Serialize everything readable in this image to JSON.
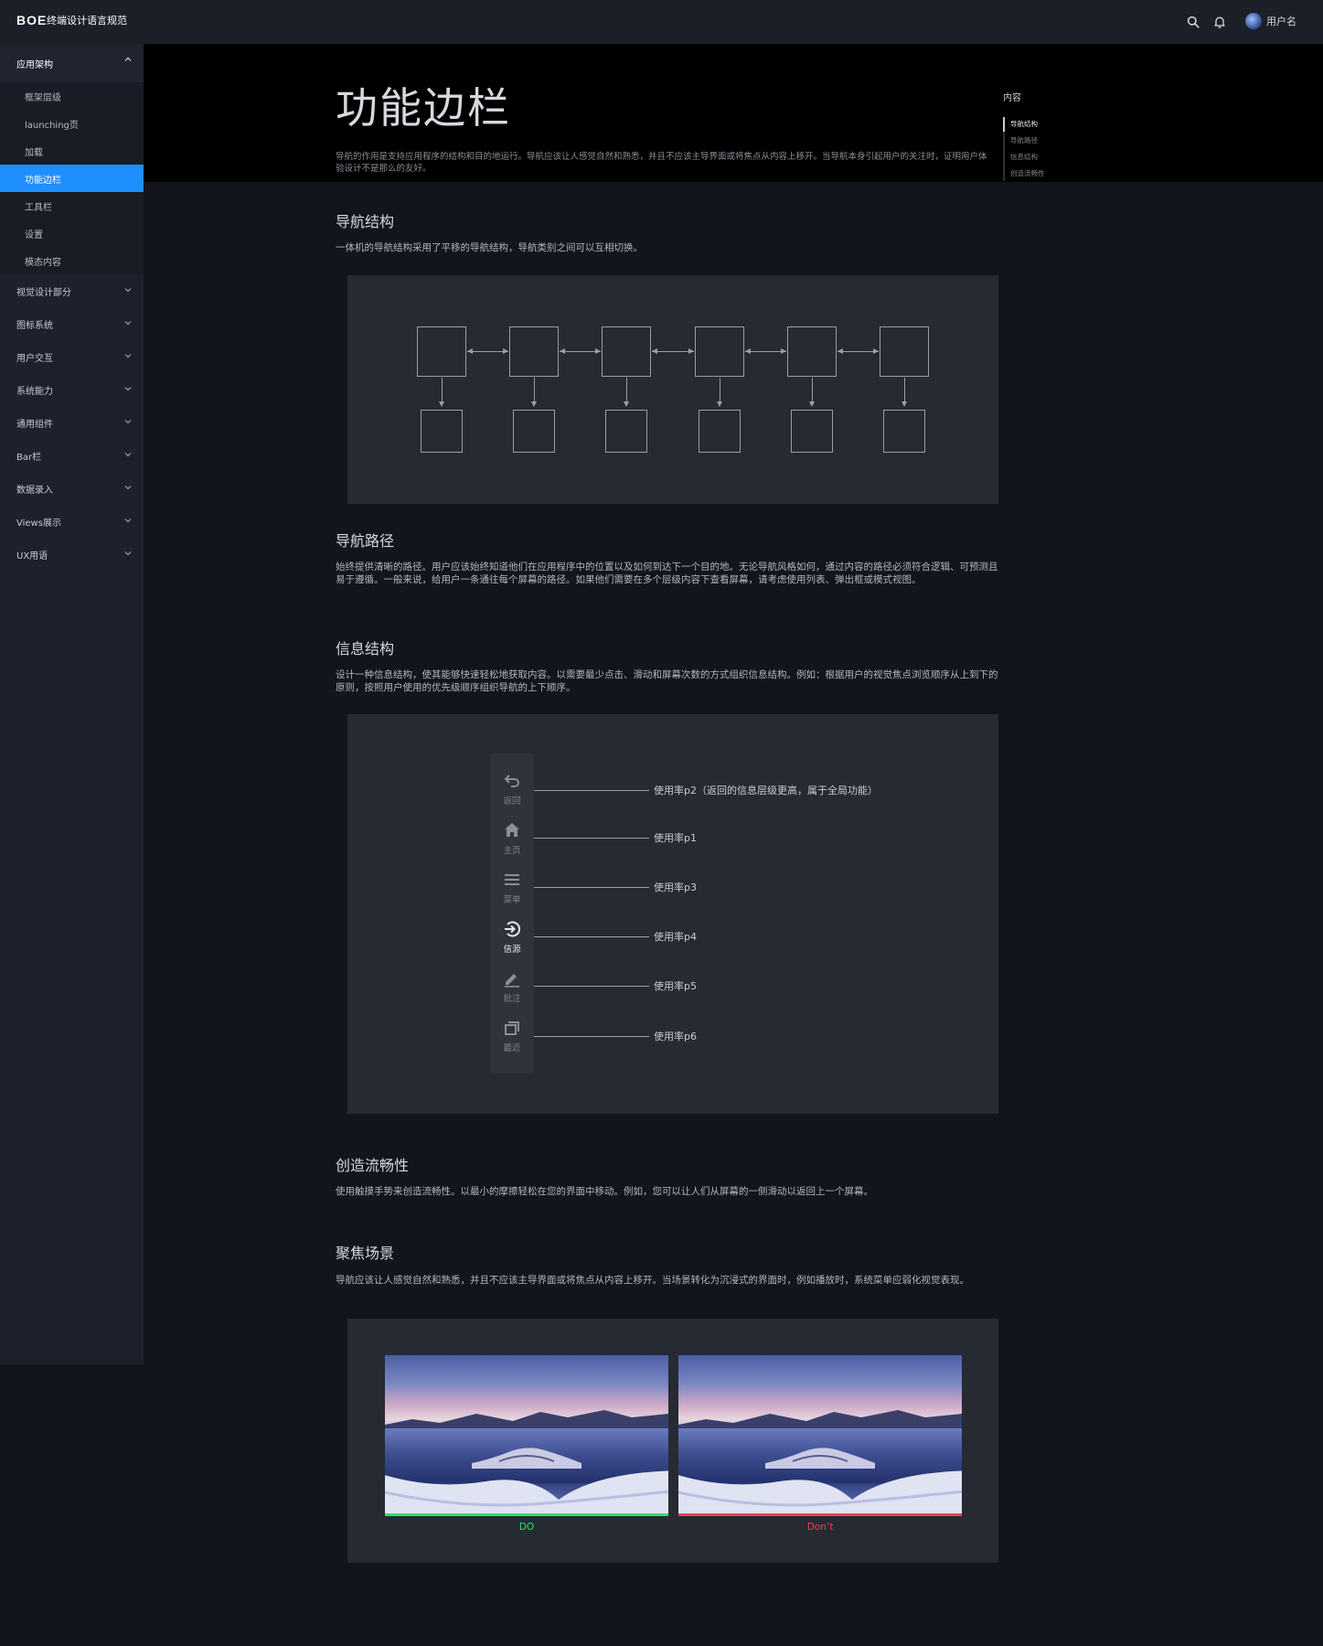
{
  "header": {
    "logo": "BOE",
    "app_title": "终端设计语言规范",
    "username": "用户名",
    "icons": [
      "search-icon",
      "bell-icon",
      "avatar"
    ]
  },
  "sidebar": {
    "open_group": "应用架构",
    "sub_items": [
      "框架层级",
      "launching页",
      "加载",
      "功能边栏",
      "工具栏",
      "设置",
      "模态内容"
    ],
    "active_sub": "功能边栏",
    "groups": [
      "视觉设计部分",
      "图标系统",
      "用户交互",
      "系统能力",
      "通用组件",
      "Bar栏",
      "数据录入",
      "Views展示",
      "UX用语"
    ]
  },
  "page": {
    "title": "功能边栏",
    "intro": "导航的作用是支持应用程序的结构和目的地运行。导航应该让人感觉自然和熟悉，并且不应该主导界面或将焦点从内容上移开。当导航本身引起用户的关注时，证明用户体验设计不是那么的友好。"
  },
  "toc": {
    "title": "内容",
    "items": [
      "导航结构",
      "导航路径",
      "信息结构",
      "创造流畅性"
    ],
    "active": "导航结构"
  },
  "sections": {
    "nav_structure": {
      "title": "导航结构",
      "text": "一体机的导航结构采用了平移的导航结构，导航类别之间可以互相切换。"
    },
    "nav_path": {
      "title": "导航路径",
      "text": "始终提供清晰的路径。用户应该始终知道他们在应用程序中的位置以及如何到达下一个目的地。无论导航风格如何，通过内容的路径必须符合逻辑、可预测且易于遵循。一般来说，给用户一条通往每个屏幕的路径。如果他们需要在多个层级内容下查看屏幕，请考虑使用列表、弹出框或模式视图。"
    },
    "info_structure": {
      "title": "信息结构",
      "text": "设计一种信息结构，使其能够快速轻松地获取内容。以需要最少点击、滑动和屏幕次数的方式组织信息结构。例如：根据用户的视觉焦点浏览顺序从上到下的原则，按照用户使用的优先级顺序组织导航的上下顺序。",
      "rail_items": [
        {
          "label": "返回",
          "icon": "back-icon",
          "usage": "使用率p2（返回的信息层级更高，属于全局功能）"
        },
        {
          "label": "主页",
          "icon": "home-icon",
          "usage": "使用率p1"
        },
        {
          "label": "菜单",
          "icon": "menu-icon",
          "usage": "使用率p3"
        },
        {
          "label": "信源",
          "icon": "source-icon",
          "usage": "使用率p4"
        },
        {
          "label": "批注",
          "icon": "pen-icon",
          "usage": "使用率p5"
        },
        {
          "label": "最近",
          "icon": "recent-icon",
          "usage": "使用率p6"
        }
      ],
      "selected": "信源"
    },
    "fluency": {
      "title": "创造流畅性",
      "text": "使用触摸手势来创造流畅性。以最小的摩擦轻松在您的界面中移动。例如，您可以让人们从屏幕的一侧滑动以返回上一个屏幕。"
    },
    "focus": {
      "title": "聚焦场景",
      "text": "导航应该让人感觉自然和熟悉，并且不应该主导界面或将焦点从内容上移开。当场景转化为沉浸式的界面时，例如播放时，系统菜单应弱化视觉表现。",
      "do_label": "DO",
      "dont_label": "Don’t",
      "do_color": "#2fe06a",
      "dont_color": "#f0405a"
    }
  }
}
